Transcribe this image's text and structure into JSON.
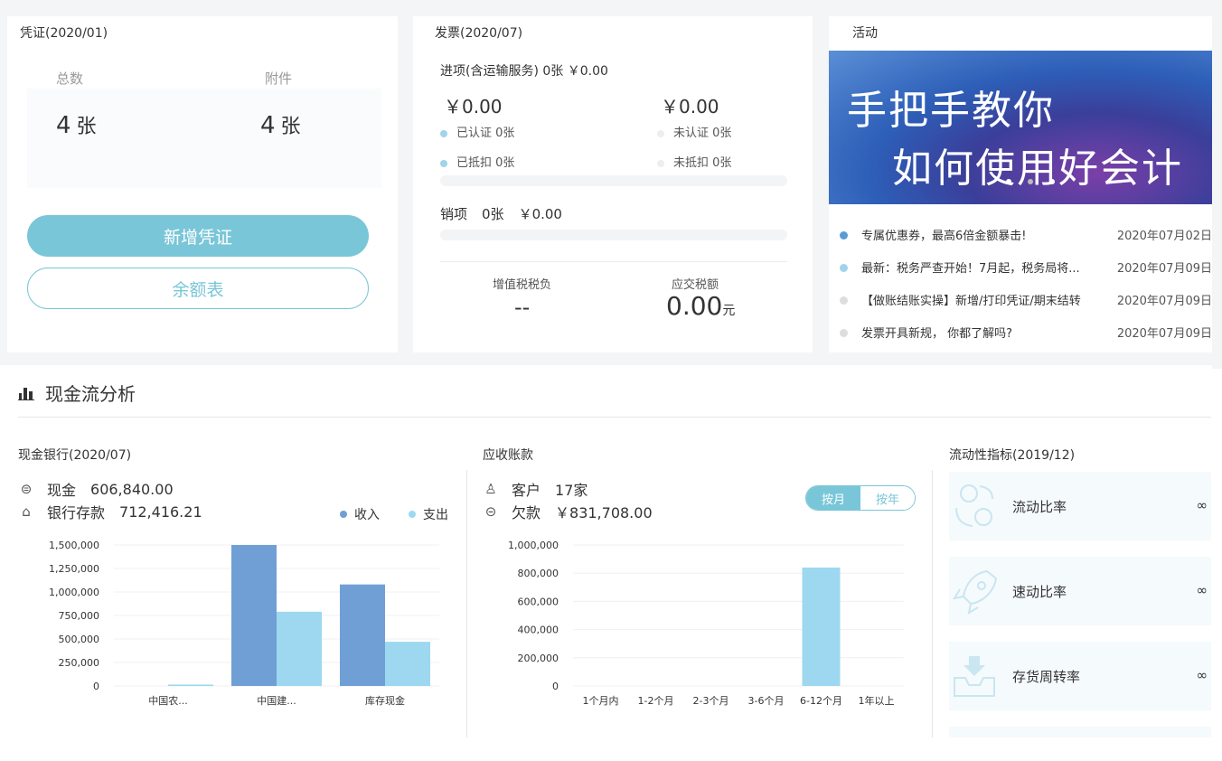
{
  "voucher": {
    "title": "凭证(2020/01)",
    "total_label": "总数",
    "total_value": "4",
    "attach_label": "附件",
    "attach_value": "4",
    "unit": "张",
    "add_button": "新增凭证",
    "balance_button": "余额表"
  },
  "invoice": {
    "title": "发票(2020/07)",
    "input_line": "进项(含运输服务) 0张  ￥0.00",
    "amount_left": "￥0.00",
    "amount_right": "￥0.00",
    "certified": "已认证   0张",
    "uncertified": "未认证   0张",
    "deducted": "已抵扣   0张",
    "undeducted": "未抵扣   0张",
    "output_label": "销项",
    "output_count": "0张",
    "output_amount": "￥0.00",
    "vat_label": "增值税税负",
    "vat_value": "--",
    "tax_due_label": "应交税额",
    "tax_due_value": "0.00",
    "tax_due_unit": "元"
  },
  "activity": {
    "title": "活动",
    "banner_line1": "手把手教你",
    "banner_line2": "如何使用好会计",
    "news": [
      {
        "text": "专属优惠券，最高6倍金额暴击!",
        "date": "2020年07月02日",
        "color": "#5b9bd5"
      },
      {
        "text": "最新：税务严查开始！7月起，税务局将...",
        "date": "2020年07月09日",
        "color": "#9fd4ea"
      },
      {
        "text": "【做账结账实操】新增/打印凭证/期末结转",
        "date": "2020年07月09日",
        "color": "#dddddd"
      },
      {
        "text": "发票开具新规， 你都了解吗?",
        "date": "2020年07月09日",
        "color": "#dddddd"
      }
    ]
  },
  "section": {
    "title": "现金流分析"
  },
  "cash": {
    "title": "现金银行(2020/07)",
    "cash_label": "现金",
    "cash_value": "606,840.00",
    "bank_label": "银行存款",
    "bank_value": "712,416.21",
    "legend_income": "收入",
    "legend_expense": "支出",
    "income_color": "#6f9fd5",
    "expense_color": "#9dd8f0"
  },
  "receivable": {
    "title": "应收账款",
    "customer_label": "客户",
    "customer_value": "17家",
    "owed_label": "欠款",
    "owed_value": "￥831,708.00",
    "toggle_month": "按月",
    "toggle_year": "按年"
  },
  "liquidity": {
    "title": "流动性指标(2019/12)",
    "items": [
      {
        "label": "流动比率",
        "value": "∞"
      },
      {
        "label": "速动比率",
        "value": "∞"
      },
      {
        "label": "存货周转率",
        "value": "∞"
      }
    ]
  },
  "chart_data": [
    {
      "type": "bar",
      "categories": [
        "中国农...",
        "中国建...",
        "库存现金"
      ],
      "series": [
        {
          "name": "收入",
          "values": [
            0,
            1500000,
            1080000
          ]
        },
        {
          "name": "支出",
          "values": [
            15000,
            790000,
            470000
          ]
        }
      ],
      "yticks": [
        "0",
        "250,000",
        "500,000",
        "750,000",
        "1,000,000",
        "1,250,000",
        "1,500,000"
      ],
      "ylim": [
        0,
        1500000
      ]
    },
    {
      "type": "bar",
      "categories": [
        "1个月内",
        "1-2个月",
        "2-3个月",
        "3-6个月",
        "6-12个月",
        "1年以上"
      ],
      "values": [
        0,
        0,
        0,
        0,
        840000,
        0
      ],
      "yticks": [
        "0",
        "200,000",
        "400,000",
        "600,000",
        "800,000",
        "1,000,000"
      ],
      "ylim": [
        0,
        1000000
      ]
    }
  ]
}
